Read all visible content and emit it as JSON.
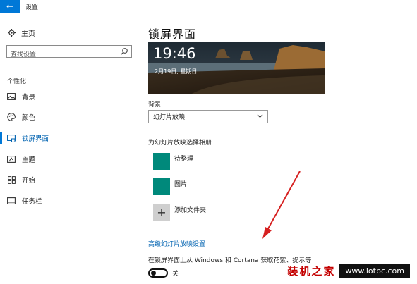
{
  "window": {
    "title": "设置",
    "back_icon": "arrow-left-icon"
  },
  "sidebar": {
    "home_label": "主页",
    "search_placeholder": "查找设置",
    "section_label": "个性化",
    "items": [
      {
        "label": "背景",
        "icon": "image-icon"
      },
      {
        "label": "颜色",
        "icon": "palette-icon"
      },
      {
        "label": "锁屏界面",
        "icon": "lock-screen-icon",
        "active": true
      },
      {
        "label": "主题",
        "icon": "theme-icon"
      },
      {
        "label": "开始",
        "icon": "start-grid-icon"
      },
      {
        "label": "任务栏",
        "icon": "taskbar-icon"
      }
    ]
  },
  "main": {
    "title": "锁屏界面",
    "preview": {
      "time": "19:46",
      "date": "2月19日, 星期日"
    },
    "background_label": "背景",
    "background_value": "幻灯片放映",
    "album_section_label": "为幻灯片放映选择相册",
    "albums": [
      {
        "label": "待整理"
      },
      {
        "label": "图片"
      }
    ],
    "add_folder_label": "添加文件夹",
    "advanced_link": "高级幻灯片放映设置",
    "tips_label": "在锁屏界面上从 Windows 和 Cortana 获取花絮、提示等",
    "toggle_state": "关"
  },
  "watermark": {
    "text": "装机之家",
    "url": "www.lotpc.com"
  },
  "colors": {
    "accent": "#0078d7",
    "tile": "#00897b",
    "arrow": "#d62020"
  }
}
